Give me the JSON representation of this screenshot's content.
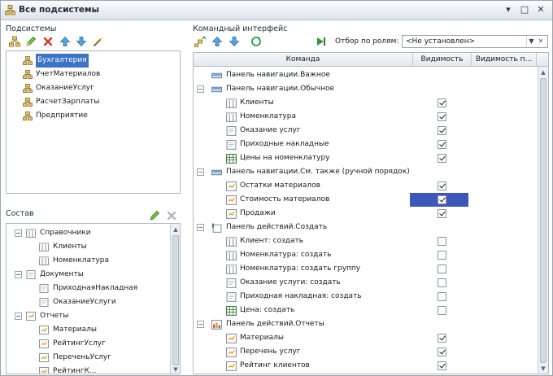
{
  "window": {
    "title": "Все подсистемы"
  },
  "subsystems": {
    "label": "Подсистемы",
    "items": [
      {
        "label": "Бухгалтерия",
        "selected": true
      },
      {
        "label": "УчетМатериалов"
      },
      {
        "label": "ОказаниеУслуг"
      },
      {
        "label": "РасчетЗарплаты"
      },
      {
        "label": "Предприятие"
      }
    ]
  },
  "composition": {
    "label": "Состав",
    "rows": [
      {
        "label": "Справочники",
        "level": 0,
        "expander": "−",
        "icon": "catalog-icon"
      },
      {
        "label": "Клиенты",
        "level": 1,
        "icon": "catalog-icon"
      },
      {
        "label": "Номенклатура",
        "level": 1,
        "icon": "catalog-icon"
      },
      {
        "label": "Документы",
        "level": 0,
        "expander": "−",
        "icon": "document-icon"
      },
      {
        "label": "ПриходнаяНакладная",
        "level": 1,
        "icon": "document-icon"
      },
      {
        "label": "ОказаниеУслуги",
        "level": 1,
        "icon": "document-icon"
      },
      {
        "label": "Отчеты",
        "level": 0,
        "expander": "−",
        "icon": "report-icon"
      },
      {
        "label": "Материалы",
        "level": 1,
        "icon": "report-icon"
      },
      {
        "label": "РейтингУслуг",
        "level": 1,
        "icon": "report-icon"
      },
      {
        "label": "ПереченьУслуг",
        "level": 1,
        "icon": "report-icon"
      },
      {
        "label": "РейтингК...",
        "level": 1,
        "icon": "report-icon"
      }
    ]
  },
  "command_interface": {
    "label": "Командный интерфейс",
    "role_filter_label": "Отбор по ролям:",
    "role_filter_value": "<Не установлен>",
    "columns": [
      "Команда",
      "Видимость",
      "Видимость п..."
    ],
    "rows": [
      {
        "label": "Панель навигации.Важное",
        "level": 0,
        "icon": "panel-icon",
        "expander": ""
      },
      {
        "label": "Панель навигации.Обычное",
        "level": 0,
        "icon": "panel-icon",
        "expander": "−"
      },
      {
        "label": "Клиенты",
        "level": 1,
        "icon": "catalog-icon",
        "visible": true
      },
      {
        "label": "Номенклатура",
        "level": 1,
        "icon": "catalog-icon",
        "visible": true
      },
      {
        "label": "Оказание услуг",
        "level": 1,
        "icon": "document-icon",
        "visible": true
      },
      {
        "label": "Приходные накладные",
        "level": 1,
        "icon": "document-icon",
        "visible": true
      },
      {
        "label": "Цены на номенклатуру",
        "level": 1,
        "icon": "register-icon",
        "visible": true
      },
      {
        "label": "Панель навигации.См. также (ручной порядок)",
        "level": 0,
        "icon": "panel-icon",
        "expander": "−"
      },
      {
        "label": "Остатки материалов",
        "level": 1,
        "icon": "report-icon",
        "visible": true
      },
      {
        "label": "Стоимость материалов",
        "level": 1,
        "icon": "report-icon",
        "visible": true,
        "highlight": true
      },
      {
        "label": "Продажи",
        "level": 1,
        "icon": "report-icon",
        "visible": true
      },
      {
        "label": "Панель действий.Создать",
        "level": 0,
        "icon": "create-panel-icon",
        "expander": "−"
      },
      {
        "label": "Клиент: создать",
        "level": 1,
        "icon": "catalog-icon",
        "visible": false
      },
      {
        "label": "Номенклатура: создать",
        "level": 1,
        "icon": "catalog-icon",
        "visible": false
      },
      {
        "label": "Номенклатура: создать группу",
        "level": 1,
        "icon": "catalog-icon",
        "visible": false
      },
      {
        "label": "Оказание услуги: создать",
        "level": 1,
        "icon": "document-icon",
        "visible": false
      },
      {
        "label": "Приходная накладная: создать",
        "level": 1,
        "icon": "document-icon",
        "visible": false
      },
      {
        "label": "Цена: создать",
        "level": 1,
        "icon": "register-icon",
        "visible": false
      },
      {
        "label": "Панель действий.Отчеты",
        "level": 0,
        "icon": "reports-panel-icon",
        "expander": "−"
      },
      {
        "label": "Материалы",
        "level": 1,
        "icon": "report-icon",
        "visible": true
      },
      {
        "label": "Перечень услуг",
        "level": 1,
        "icon": "report-icon",
        "visible": true
      },
      {
        "label": "Рейтинг клиентов",
        "level": 1,
        "icon": "report-icon",
        "visible": true
      }
    ]
  },
  "colors": {
    "selection": "#3b74c6",
    "highlight_cell": "#3d58b8"
  }
}
